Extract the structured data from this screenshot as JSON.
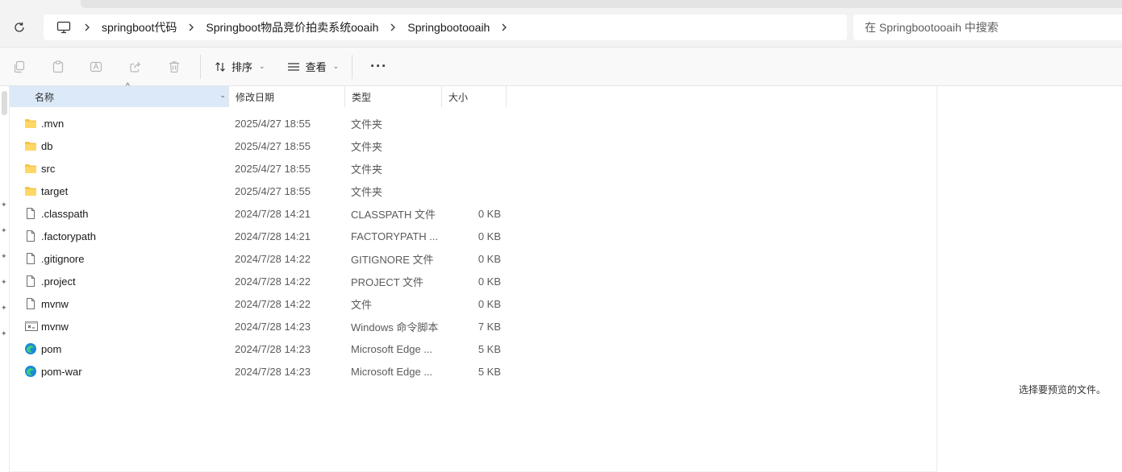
{
  "breadcrumb": {
    "items": [
      "springboot代码",
      "Springboot物品竞价拍卖系统ooaih",
      "Springbootooaih"
    ]
  },
  "search": {
    "placeholder": "在 Springbootooaih 中搜索"
  },
  "toolbar": {
    "sort_label": "排序",
    "view_label": "查看",
    "more_label": "···"
  },
  "columns": {
    "name": "名称",
    "date": "修改日期",
    "type": "类型",
    "size": "大小"
  },
  "files": [
    {
      "name": ".mvn",
      "date": "2025/4/27 18:55",
      "type": "文件夹",
      "size": "",
      "icon": "folder-icon"
    },
    {
      "name": "db",
      "date": "2025/4/27 18:55",
      "type": "文件夹",
      "size": "",
      "icon": "folder-icon"
    },
    {
      "name": "src",
      "date": "2025/4/27 18:55",
      "type": "文件夹",
      "size": "",
      "icon": "folder-icon"
    },
    {
      "name": "target",
      "date": "2025/4/27 18:55",
      "type": "文件夹",
      "size": "",
      "icon": "folder-icon"
    },
    {
      "name": ".classpath",
      "date": "2024/7/28 14:21",
      "type": "CLASSPATH 文件",
      "size": "0 KB",
      "icon": "file-icon"
    },
    {
      "name": ".factorypath",
      "date": "2024/7/28 14:21",
      "type": "FACTORYPATH ...",
      "size": "0 KB",
      "icon": "file-icon"
    },
    {
      "name": ".gitignore",
      "date": "2024/7/28 14:22",
      "type": "GITIGNORE 文件",
      "size": "0 KB",
      "icon": "file-icon"
    },
    {
      "name": ".project",
      "date": "2024/7/28 14:22",
      "type": "PROJECT 文件",
      "size": "0 KB",
      "icon": "file-icon"
    },
    {
      "name": "mvnw",
      "date": "2024/7/28 14:22",
      "type": "文件",
      "size": "0 KB",
      "icon": "file-icon"
    },
    {
      "name": "mvnw",
      "date": "2024/7/28 14:23",
      "type": "Windows 命令脚本",
      "size": "7 KB",
      "icon": "script-icon"
    },
    {
      "name": "pom",
      "date": "2024/7/28 14:23",
      "type": "Microsoft Edge ...",
      "size": "5 KB",
      "icon": "edge-icon"
    },
    {
      "name": "pom-war",
      "date": "2024/7/28 14:23",
      "type": "Microsoft Edge ...",
      "size": "5 KB",
      "icon": "edge-icon"
    }
  ],
  "preview": {
    "message": "选择要预览的文件。"
  }
}
